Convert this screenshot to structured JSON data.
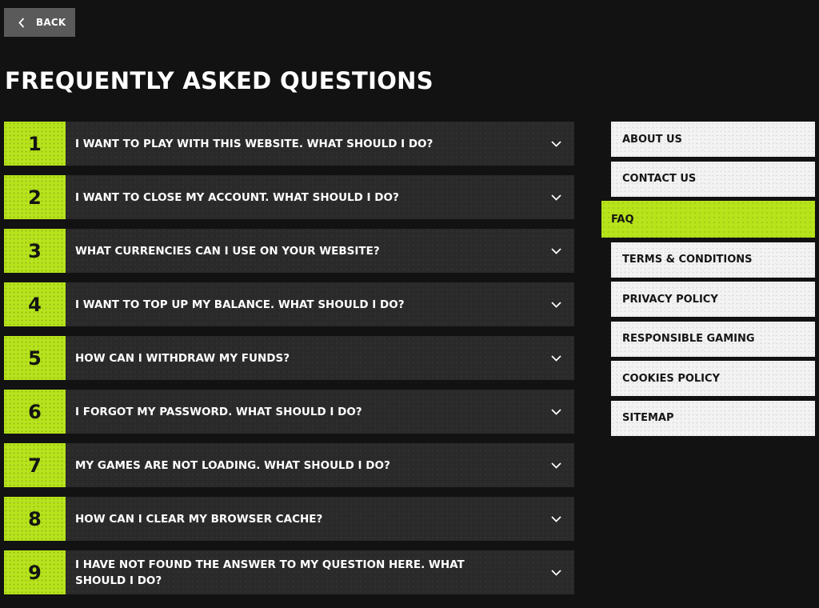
{
  "back": {
    "label": "BACK",
    "icon": "chevron-left-icon"
  },
  "title": "FREQUENTLY ASKED QUESTIONS",
  "colors": {
    "accent": "#b6e31a",
    "background": "#121212",
    "card": "#2a2a2a",
    "nav_bg": "#f3f3f3"
  },
  "faq": [
    {
      "number": "1",
      "question": "I WANT TO PLAY WITH THIS WEBSITE. WHAT SHOULD I DO?"
    },
    {
      "number": "2",
      "question": "I WANT TO CLOSE MY ACCOUNT. WHAT SHOULD I DO?"
    },
    {
      "number": "3",
      "question": "WHAT CURRENCIES CAN I USE ON YOUR WEBSITE?"
    },
    {
      "number": "4",
      "question": "I WANT TO TOP UP MY BALANCE. WHAT SHOULD I DO?"
    },
    {
      "number": "5",
      "question": "HOW CAN I WITHDRAW MY FUNDS?"
    },
    {
      "number": "6",
      "question": "I FORGOT MY PASSWORD. WHAT SHOULD I DO?"
    },
    {
      "number": "7",
      "question": "MY GAMES ARE NOT LOADING. WHAT SHOULD I DO?"
    },
    {
      "number": "8",
      "question": "HOW CAN I CLEAR MY BROWSER CACHE?"
    },
    {
      "number": "9",
      "question": "I HAVE NOT FOUND THE ANSWER TO MY QUESTION HERE. WHAT SHOULD I DO?"
    }
  ],
  "nav": [
    {
      "label": "ABOUT US",
      "active": false
    },
    {
      "label": "CONTACT US",
      "active": false
    },
    {
      "label": "FAQ",
      "active": true
    },
    {
      "label": "TERMS & CONDITIONS",
      "active": false
    },
    {
      "label": "PRIVACY POLICY",
      "active": false
    },
    {
      "label": "RESPONSIBLE GAMING",
      "active": false
    },
    {
      "label": "COOKIES POLICY",
      "active": false
    },
    {
      "label": "SITEMAP",
      "active": false
    }
  ]
}
